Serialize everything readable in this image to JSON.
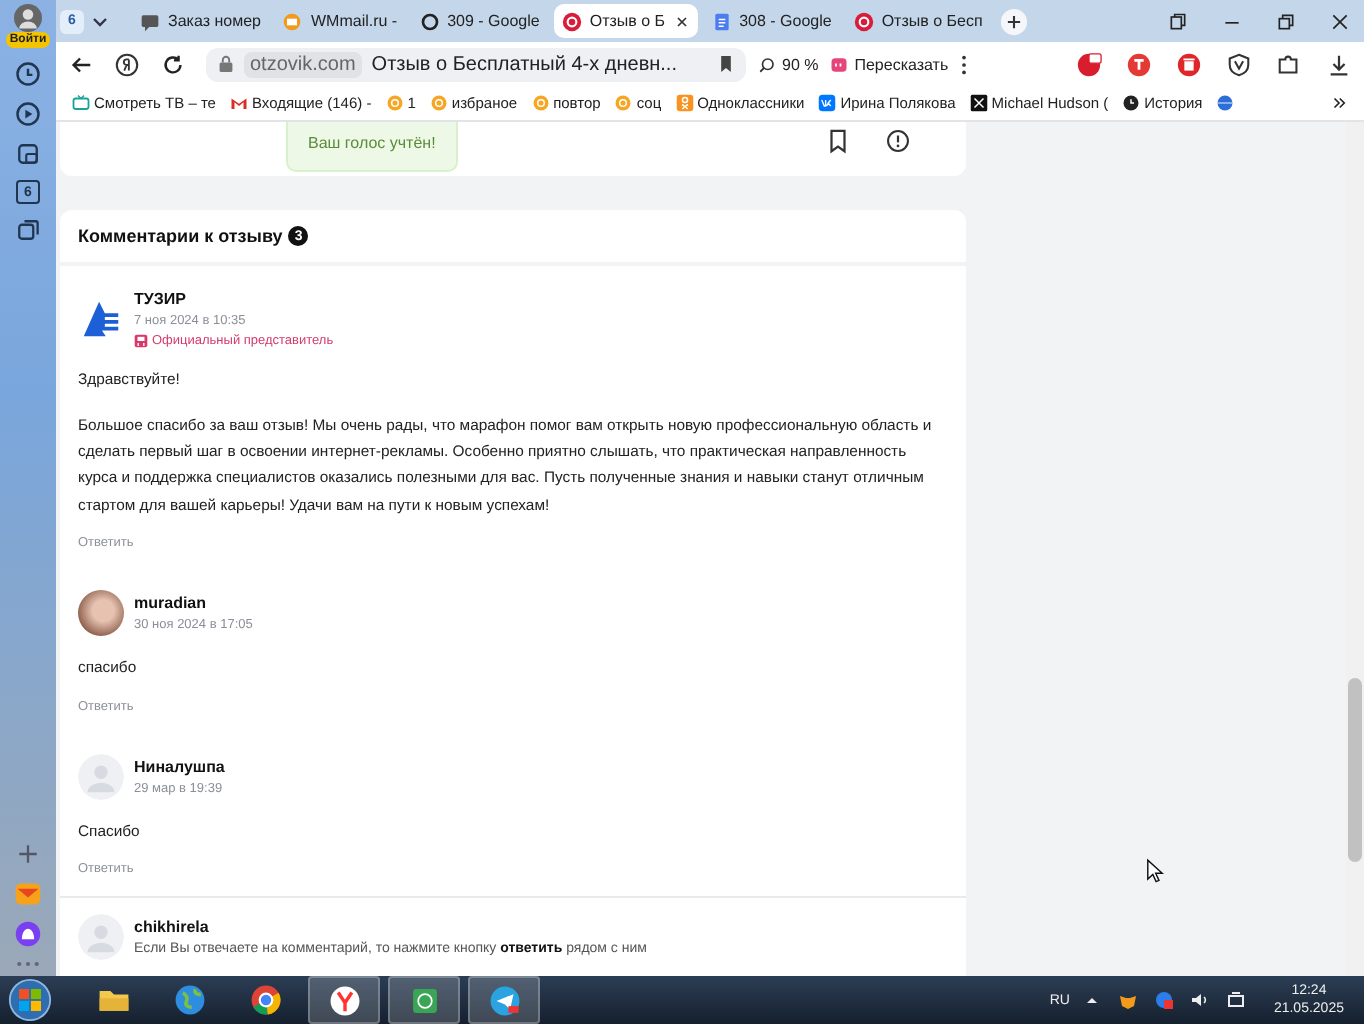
{
  "sidebar": {
    "login": "Войти",
    "tab_count": "6"
  },
  "tabs": [
    {
      "kind": "chat",
      "label": "Заказ номер",
      "selected": false
    },
    {
      "kind": "mail",
      "label": "WMmail.ru -",
      "selected": false
    },
    {
      "kind": "ring",
      "label": "309 - Google",
      "selected": false
    },
    {
      "kind": "review",
      "label": "Отзыв о Б",
      "selected": true
    },
    {
      "kind": "doc",
      "label": "308 - Google",
      "selected": false
    },
    {
      "kind": "review",
      "label": "Отзыв о Бесп",
      "selected": false
    }
  ],
  "tab_counter": "6",
  "toolbar": {
    "domain": "otzovik.com",
    "page_title": "Отзыв о Бесплатный 4-х дневн...",
    "zoom": "90 %",
    "retell": "Пересказать"
  },
  "bookmarks": [
    {
      "kind": "tv",
      "label": "Смотреть ТВ – те"
    },
    {
      "kind": "gmail",
      "label": "Входящие (146) -"
    },
    {
      "kind": "fav",
      "label": "1"
    },
    {
      "kind": "fav",
      "label": "избраное"
    },
    {
      "kind": "fav",
      "label": "повтор"
    },
    {
      "kind": "fav",
      "label": "соц"
    },
    {
      "kind": "ok",
      "label": "Одноклассники"
    },
    {
      "kind": "vk",
      "label": "Ирина Полякова"
    },
    {
      "kind": "x",
      "label": "Michael Hudson ("
    },
    {
      "kind": "history",
      "label": "История"
    }
  ],
  "vote": {
    "message": "Ваш голос учтён!"
  },
  "comments_section": {
    "title": "Комментарии к отзыву",
    "count": "3"
  },
  "comments": [
    {
      "kind": "logo",
      "author": "ТУЗИР",
      "date": "7 ноя 2024 в 10:35",
      "badge": "Официальный представитель",
      "body": [
        "Здравствуйте!",
        "Большое спасибо за ваш отзыв! Мы очень рады, что марафон помог вам открыть новую профессиональную область и сделать первый шаг в освоении интернет-рекламы. Особенно приятно слышать, что практическая направленность курса и поддержка специалистов оказались полезными для вас. Пусть полученные знания и навыки станут отличным стартом для вашей карьеры! Удачи вам на пути к новым успехам!"
      ],
      "reply": "Ответить"
    },
    {
      "kind": "photo",
      "author": "muradian",
      "date": "30 ноя 2024 в 17:05",
      "body": [
        "спасибо"
      ],
      "reply": "Ответить"
    },
    {
      "kind": "default",
      "author": "Ниналушпа",
      "date": "29 мар в 19:39",
      "body": [
        "Спасибо"
      ],
      "reply": "Ответить"
    }
  ],
  "new_comment": {
    "author": "chikhirela",
    "hint": "Если Вы отвечаете на комментарий, то нажмите кнопку **ответить** рядом с ним"
  },
  "taskbar": {
    "language": "RU",
    "time": "12:24",
    "date": "21.05.2025"
  }
}
